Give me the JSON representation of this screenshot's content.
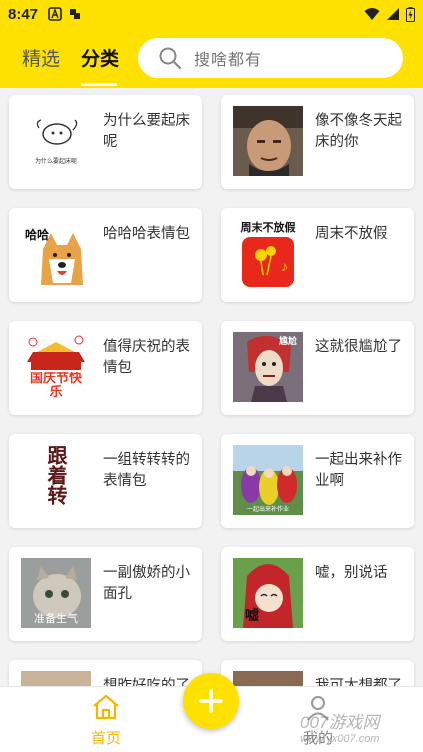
{
  "status_bar": {
    "time": "8:47"
  },
  "header": {
    "tabs": [
      {
        "label": "精选",
        "active": false
      },
      {
        "label": "分类",
        "active": true
      }
    ],
    "search": {
      "placeholder": "搜啥都有"
    }
  },
  "categories": [
    {
      "title": "为什么要起床呢",
      "thumb_caption": "为什么要起床呢"
    },
    {
      "title": "像不像冬天起床的你"
    },
    {
      "title": "哈哈哈表情包",
      "thumb_caption": "哈哈"
    },
    {
      "title": "周末不放假",
      "thumb_caption": "周末不放假"
    },
    {
      "title": "值得庆祝的表情包",
      "thumb_caption": "国庆节快乐"
    },
    {
      "title": "这就很尴尬了",
      "thumb_caption": "尴尬"
    },
    {
      "title": "一组转转转的表情包",
      "thumb_caption": "跟着转"
    },
    {
      "title": "一起出来补作业啊",
      "thumb_caption": "一起出来补作业"
    },
    {
      "title": "一副傲娇的小面孔",
      "thumb_caption": "准备生气"
    },
    {
      "title": "嘘，别说话",
      "thumb_caption": "嘘"
    },
    {
      "title": "想昨好吃的了"
    },
    {
      "title": "我可太想都了"
    }
  ],
  "bottom_nav": {
    "home_label": "首页",
    "mine_label": "我的"
  },
  "watermark": {
    "text": "007游戏网",
    "url": "www.yx007.com"
  },
  "colors": {
    "accent": "#ffe100",
    "home_active": "#f2b800"
  }
}
